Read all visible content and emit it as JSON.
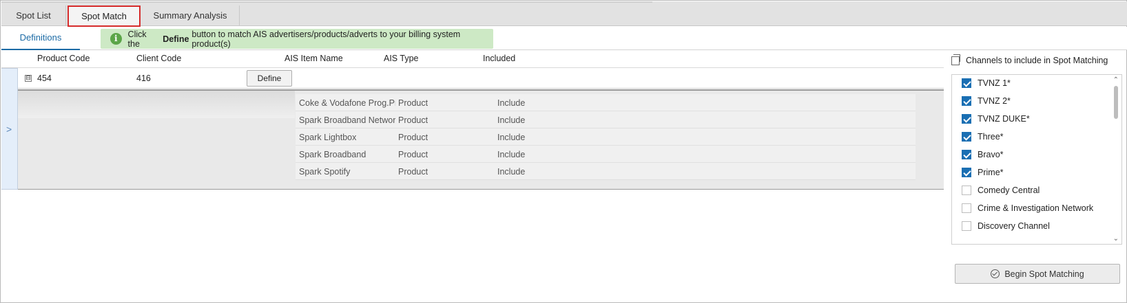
{
  "tabs": [
    "Spot List",
    "Spot Match",
    "Summary Analysis"
  ],
  "subtab": "Definitions",
  "banner": {
    "prefix": "Click the",
    "bold": "Define",
    "suffix": "button to match AIS advertisers/products/adverts to your billing system product(s)"
  },
  "grid": {
    "headers": {
      "product_code": "Product Code",
      "client_code": "Client Code",
      "ais_item_name": "AIS Item Name",
      "ais_type": "AIS Type",
      "included": "Included"
    },
    "row": {
      "expander": "⊟",
      "product_code": "454",
      "client_code": "416",
      "define_label": "Define"
    },
    "detail_rows": [
      {
        "name": "Coke & Vodafone Prog.Pro",
        "type": "Product",
        "included": "Include"
      },
      {
        "name": "Spark Broadband Network",
        "type": "Product",
        "included": "Include"
      },
      {
        "name": "Spark Lightbox",
        "type": "Product",
        "included": "Include"
      },
      {
        "name": "Spark Broadband",
        "type": "Product",
        "included": "Include"
      },
      {
        "name": "Spark Spotify",
        "type": "Product",
        "included": "Include"
      }
    ]
  },
  "channels": {
    "title": "Channels to include in Spot Matching",
    "items": [
      {
        "label": "TVNZ 1*",
        "checked": true
      },
      {
        "label": "TVNZ 2*",
        "checked": true
      },
      {
        "label": "TVNZ DUKE*",
        "checked": true
      },
      {
        "label": "Three*",
        "checked": true
      },
      {
        "label": "Bravo*",
        "checked": true
      },
      {
        "label": "Prime*",
        "checked": true
      },
      {
        "label": "Comedy Central",
        "checked": false
      },
      {
        "label": "Crime & Investigation Network",
        "checked": false
      },
      {
        "label": "Discovery Channel",
        "checked": false
      }
    ]
  },
  "begin_button": "Begin Spot Matching",
  "colors": {
    "accent": "#1a6fb3",
    "banner": "#cde9c5",
    "tab_highlight": "#d62b2b"
  }
}
